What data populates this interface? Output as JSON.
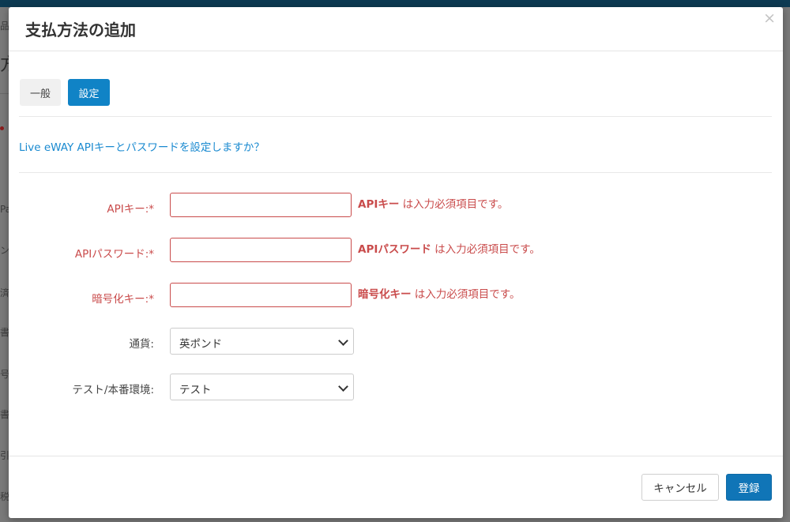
{
  "background": {
    "fragments": [
      "品",
      "方",
      "Pa",
      "ン",
      "済",
      "書",
      "号",
      "先",
      "書",
      "引",
      "税"
    ]
  },
  "modal": {
    "title": "支払方法の追加",
    "close_label": "×",
    "tabs": [
      {
        "label": "一般",
        "active": false
      },
      {
        "label": "設定",
        "active": true
      }
    ],
    "notice": "Live eWAY APIキーとパスワードを設定しますか？",
    "fields": [
      {
        "label": "APIキー:",
        "required_mark": "*",
        "value": "",
        "error_field": "APIキー",
        "error_text": " は入力必須項目です。"
      },
      {
        "label": "APIパスワード:",
        "required_mark": "*",
        "value": "",
        "error_field": "APIパスワード",
        "error_text": " は入力必須項目です。"
      },
      {
        "label": "暗号化キー:",
        "required_mark": "*",
        "value": "",
        "error_field": "暗号化キー",
        "error_text": " は入力必須項目です。"
      }
    ],
    "selects": [
      {
        "label": "通貨:",
        "value": "英ポンド"
      },
      {
        "label": "テスト/本番環境:",
        "value": "テスト"
      }
    ],
    "footer": {
      "cancel_label": "キャンセル",
      "submit_label": "登録"
    }
  },
  "colors": {
    "primary": "#1083c6",
    "error": "#c94b4b",
    "link": "#1a8ad0"
  }
}
